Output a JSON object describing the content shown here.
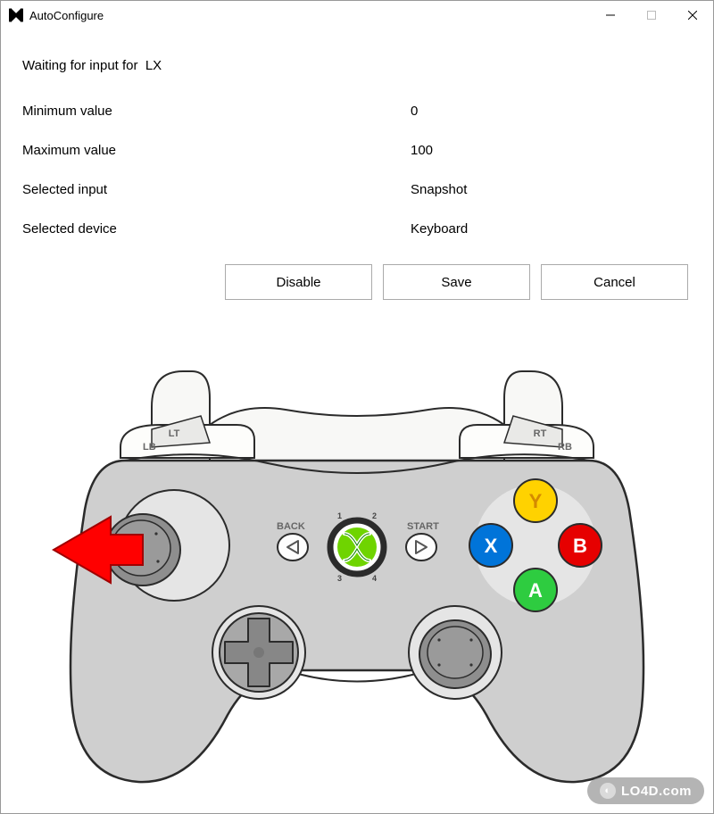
{
  "window": {
    "title": "AutoConfigure"
  },
  "status": {
    "prefix": "Waiting for input for",
    "axis": "LX"
  },
  "fields": {
    "min_label": "Minimum value",
    "min_value": "0",
    "max_label": "Maximum value",
    "max_value": "100",
    "input_label": "Selected input",
    "input_value": "Snapshot",
    "device_label": "Selected device",
    "device_value": "Keyboard"
  },
  "buttons": {
    "disable": "Disable",
    "save": "Save",
    "cancel": "Cancel"
  },
  "controller": {
    "lt": "LT",
    "lb": "LB",
    "rt": "RT",
    "rb": "RB",
    "back": "BACK",
    "start": "START",
    "a": "A",
    "b": "B",
    "x": "X",
    "y": "Y",
    "n1": "1",
    "n2": "2",
    "n3": "3",
    "n4": "4"
  },
  "watermark": "LO4D.com"
}
